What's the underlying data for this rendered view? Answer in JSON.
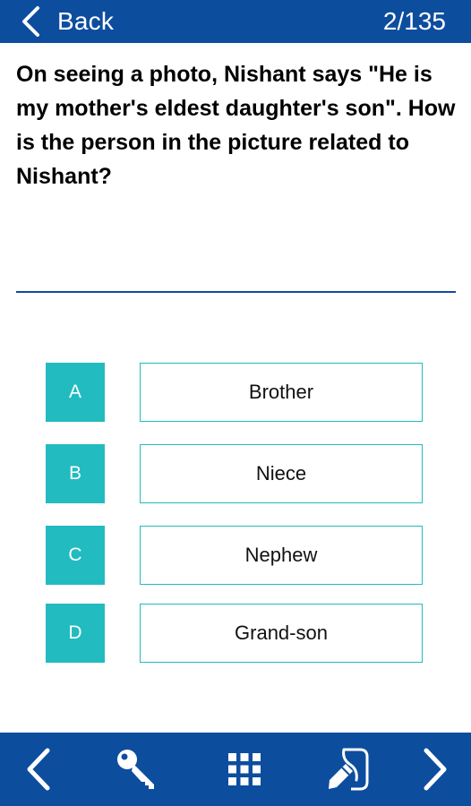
{
  "header": {
    "back_label": "Back",
    "counter": "2/135"
  },
  "question": {
    "text": "On seeing a photo, Nishant says \"He is my mother's eldest daughter's son\". How is the person in the picture related to Nishant?"
  },
  "options": [
    {
      "letter": "A",
      "text": "Brother"
    },
    {
      "letter": "B",
      "text": "Niece"
    },
    {
      "letter": "C",
      "text": "Nephew"
    },
    {
      "letter": "D",
      "text": "Grand-son"
    }
  ],
  "toolbar": {
    "icons": [
      "chevron-left-icon",
      "key-icon",
      "grid-icon",
      "notes-edit-icon",
      "chevron-right-icon"
    ]
  },
  "colors": {
    "primary": "#0d4d9e",
    "accent": "#22bbbf",
    "background": "#ffffff"
  }
}
